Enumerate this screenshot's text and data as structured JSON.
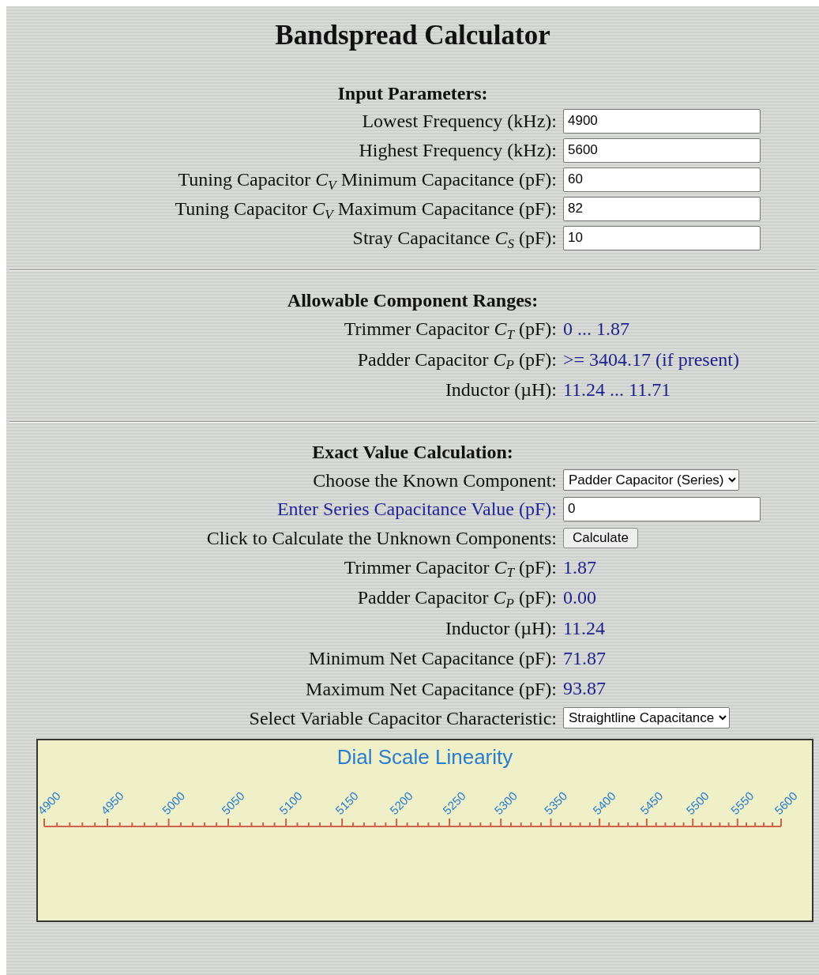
{
  "title": "Bandspread Calculator",
  "sections": [
    {
      "heading": "Input Parameters:",
      "rows": [
        {
          "kind": "input",
          "label": "Lowest Frequency (kHz):",
          "value": "4900",
          "emphasized": false
        },
        {
          "kind": "input",
          "label": "Highest Frequency (kHz):",
          "value": "5600",
          "emphasized": false
        },
        {
          "kind": "input",
          "label": "Tuning Capacitor *C*$_{V}$ Minimum Capacitance (pF):",
          "value": "60",
          "emphasized": false
        },
        {
          "kind": "input",
          "label": "Tuning Capacitor *C*$_{V}$ Maximum Capacitance (pF):",
          "value": "82",
          "emphasized": false
        },
        {
          "kind": "input",
          "label": "Stray Capacitance *C*$_{S}$ (pF):",
          "value": "10",
          "emphasized": false
        }
      ]
    },
    {
      "heading": "Allowable Component Ranges:",
      "rows": [
        {
          "kind": "output",
          "label": "Trimmer Capacitor *C*$_{T}$ (pF):",
          "value": "0 ... 1.87",
          "emphasized": false
        },
        {
          "kind": "output",
          "label": "Padder Capacitor *C*$_{P}$ (pF):",
          "value": ">= 3404.17 (if present)",
          "emphasized": false
        },
        {
          "kind": "output",
          "label": "Inductor (µH):",
          "value": "11.24 ... 11.71",
          "emphasized": false
        }
      ]
    },
    {
      "heading": "Exact Value Calculation:",
      "rows": [
        {
          "kind": "select",
          "label": "Choose the Known Component:",
          "value": "Padder Capacitor (Series)",
          "emphasized": false
        },
        {
          "kind": "input",
          "label": "Enter Series Capacitance Value (pF):",
          "value": "0",
          "emphasized": true
        },
        {
          "kind": "button",
          "label": "Click to Calculate the Unknown Components:",
          "value": "Calculate",
          "emphasized": false
        },
        {
          "kind": "output",
          "label": "Trimmer Capacitor *C*$_{T}$ (pF):",
          "value": "1.87",
          "emphasized": false
        },
        {
          "kind": "output",
          "label": "Padder Capacitor *C*$_{P}$ (pF):",
          "value": "0.00",
          "emphasized": false
        },
        {
          "kind": "output",
          "label": "Inductor (µH):",
          "value": "11.24",
          "emphasized": false
        },
        {
          "kind": "output",
          "label": "Minimum Net Capacitance (pF):",
          "value": "71.87",
          "emphasized": false
        },
        {
          "kind": "output",
          "label": "Maximum Net Capacitance (pF):",
          "value": "93.87",
          "emphasized": false
        },
        {
          "kind": "select",
          "label": "Select Variable Capacitor Characteristic:",
          "value": "Straightline Capacitance",
          "emphasized": false
        }
      ]
    }
  ],
  "dial": {
    "title": "Dial Scale Linearity",
    "tick_labels": [
      "4900",
      "4950",
      "5000",
      "5050",
      "5100",
      "5150",
      "5200",
      "5250",
      "5300",
      "5350",
      "5400",
      "5450",
      "5500",
      "5550",
      "5600"
    ]
  }
}
